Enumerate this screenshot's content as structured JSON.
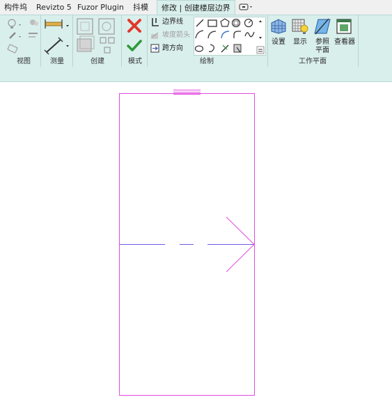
{
  "tabs": [
    {
      "label": "构件坞",
      "active": false
    },
    {
      "label": "Revizto 5",
      "active": false
    },
    {
      "label": "Fuzor Plugin",
      "active": false
    },
    {
      "label": "抖模",
      "active": false
    },
    {
      "label": "修改 | 创建楼层边界",
      "active": true
    }
  ],
  "tab_options_icon": "dropdown-options-icon",
  "panels": {
    "view": "视图",
    "measure": "测量",
    "create": "创建",
    "mode": "模式",
    "draw": "绘制",
    "work_plane": "工作平面"
  },
  "draw_tools": {
    "boundary_line": "边界线",
    "slope_arrow": "坡度箭头",
    "span_direction": "跨方向"
  },
  "work_plane_buttons": {
    "set": "设置",
    "show": "显示",
    "ref_plane_line1": "参照",
    "ref_plane_line2": "平面",
    "viewer": "查看器"
  },
  "colors": {
    "ribbon_bg": "#d9efec",
    "sketch_line": "#e14ae0",
    "span_line": "#6a5ae0",
    "finish_green": "#2f9a3a",
    "cancel_red": "#e0392b"
  }
}
